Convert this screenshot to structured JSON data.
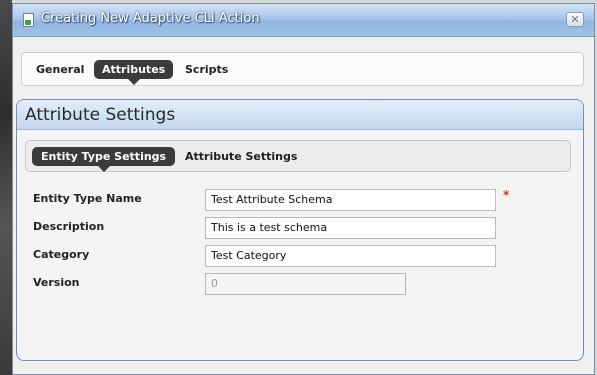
{
  "window": {
    "title": "Creating New Adaptive CLI Action",
    "close_glyph": "✕",
    "icon": "document-icon"
  },
  "tabs": [
    {
      "label": "General",
      "active": false
    },
    {
      "label": "Attributes",
      "active": true
    },
    {
      "label": "Scripts",
      "active": false
    }
  ],
  "panel": {
    "title": "Attribute Settings",
    "subtabs": [
      {
        "label": "Entity Type Settings",
        "active": true
      },
      {
        "label": "Attribute Settings",
        "active": false
      }
    ],
    "fields": [
      {
        "label": "Entity Type Name",
        "value": "Test Attribute Schema",
        "required": true
      },
      {
        "label": "Description",
        "value": "This is a test schema"
      },
      {
        "label": "Category",
        "value": "Test Category"
      },
      {
        "label": "Version",
        "value": "0",
        "disabled": true
      }
    ],
    "required_marker": "*"
  },
  "colors": {
    "title_bar": "#a9c7ea",
    "active_tab": "#3b3b3b",
    "panel_border": "#6f8fb8",
    "required": "#c0392b"
  }
}
